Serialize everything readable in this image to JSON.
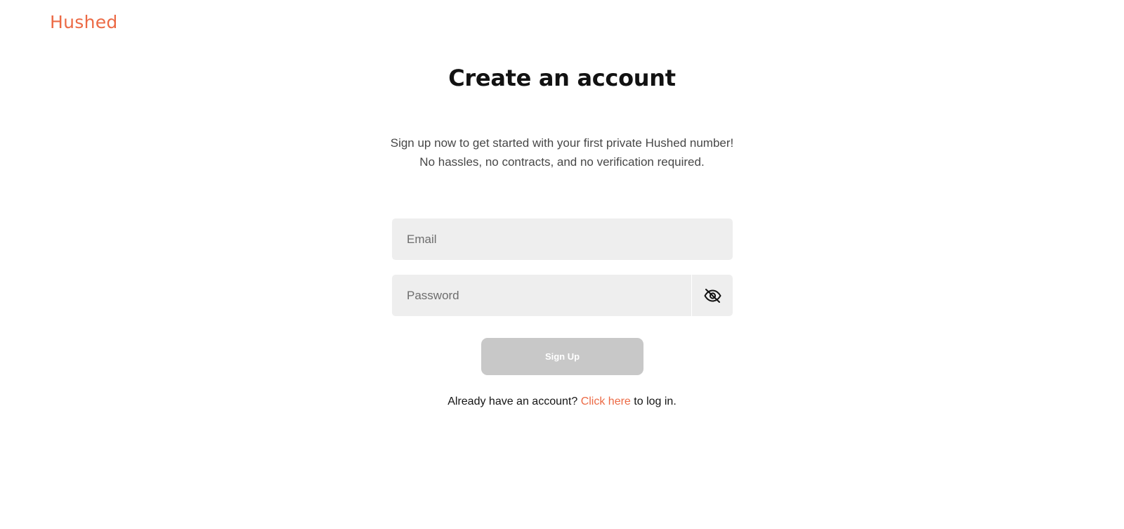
{
  "brand": {
    "logo_text": "Hushed",
    "accent_color": "#ec6a45"
  },
  "main": {
    "title": "Create an account",
    "subtitle_line1": "Sign up now to get started with your first private Hushed number!",
    "subtitle_line2": "No hassles, no contracts, and no verification required."
  },
  "form": {
    "email": {
      "placeholder": "Email",
      "value": ""
    },
    "password": {
      "placeholder": "Password",
      "value": "",
      "toggle_icon": "eye-off-icon"
    },
    "submit_label": "Sign Up",
    "submit_color": "#c8c8c8"
  },
  "login_prompt": {
    "prefix": "Already have an account?",
    "link_text": "Click here",
    "suffix": "to log in."
  }
}
